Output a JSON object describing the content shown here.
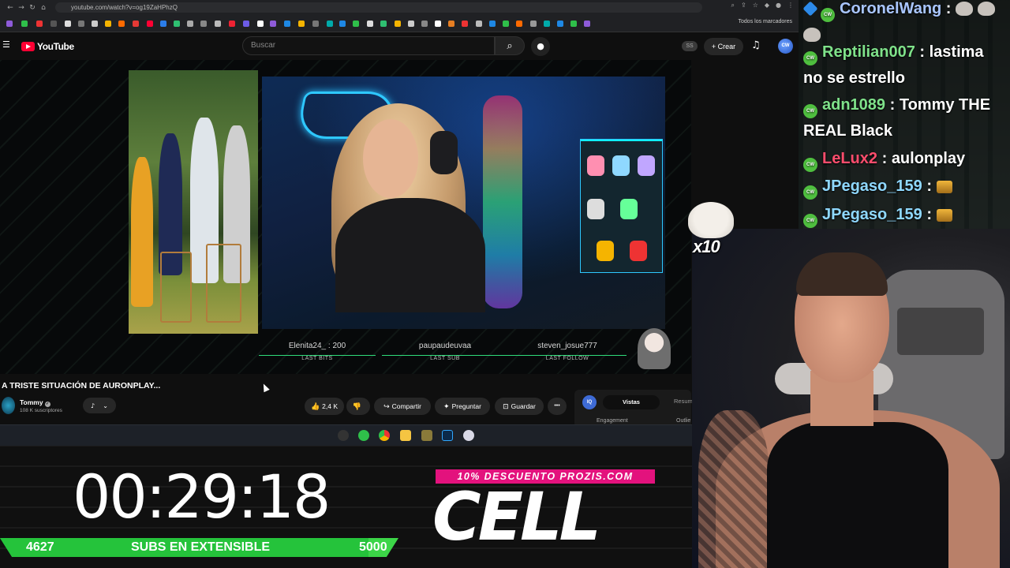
{
  "browser": {
    "url": "youtube.com/watch?v=og19ZaHPhzQ",
    "bookmarks_folder": "Todos los marcadores"
  },
  "youtube": {
    "logo_text": "YouTube",
    "search_placeholder": "Buscar",
    "ss_badge": "SS",
    "create_label": "Crear",
    "avatar_text": "CW"
  },
  "video": {
    "title": "A TRISTE SITUACIÓN DE AURONPLAY...",
    "stats": [
      {
        "name": "Elenita24_ : 200",
        "label": "LAST BITS"
      },
      {
        "name": "paupaudeuvaa",
        "label": "LAST SUB"
      },
      {
        "name": "steven_josue777",
        "label": "LAST FOLLOW"
      }
    ]
  },
  "channel": {
    "name": "Tommy",
    "subscribers": "108 K suscriptores"
  },
  "actions": {
    "likes": "2,4 K",
    "share": "Compartir",
    "ask": "Preguntar",
    "save": "Guardar",
    "more": "•••"
  },
  "side_panel": {
    "icon_text": "IQ",
    "tab_active": "Vistas",
    "tab_other": "Resum",
    "engagement": "Engagement",
    "outlier": "Outlie"
  },
  "overlay": {
    "timer": "00:29:18",
    "subs_current": "4627",
    "subs_label": "SUBS EN EXTENSIBLE",
    "subs_goal": "5000",
    "subs_progress": 0.925,
    "promo": "10% DESCUENTO PROZIS.COM",
    "brand": "CELL",
    "emote_count": "x10"
  },
  "chat": {
    "messages": [
      {
        "user": "CoronelWang",
        "text": "",
        "color": "#a9c6ff",
        "emotes": 2
      },
      {
        "user": "Reptilian007",
        "text": "lastima no se estrello",
        "color": "#7fe28a"
      },
      {
        "user": "adn1089",
        "text": "Tommy THE REAL Black",
        "color": "#7fe28a"
      },
      {
        "user": "LeLux2",
        "text": "aulonplay",
        "color": "#ff4d6d"
      },
      {
        "user": "JPegaso_159",
        "text": "",
        "color": "#8fd8ff"
      },
      {
        "user": "JPegaso_159",
        "text": "",
        "color": "#8fd8ff"
      }
    ]
  },
  "colors": {
    "youtube_red": "#ff0033",
    "subs_green": "#25c33b",
    "promo_pink": "#e3127d"
  }
}
